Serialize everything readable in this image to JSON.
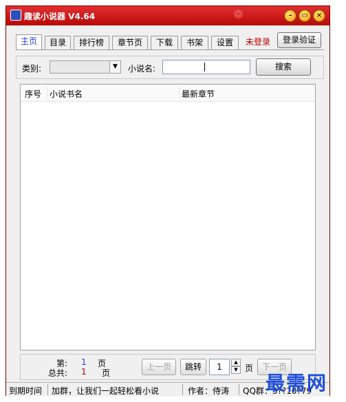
{
  "window": {
    "title": "趣读小说器 V4.64",
    "controls": {
      "minimize": "–",
      "maximize": "▭",
      "close": "×"
    }
  },
  "tabs": [
    "主页",
    "目录",
    "排行榜",
    "章节页",
    "下载",
    "书架",
    "设置"
  ],
  "active_tab": 0,
  "login": {
    "status": "未登录",
    "button": "登录验证"
  },
  "search": {
    "category_label": "类别:",
    "category_value": "",
    "name_label": "小说名:",
    "name_value": "",
    "button": "搜索"
  },
  "table": {
    "columns": [
      "序号",
      "小说书名",
      "最新章节"
    ],
    "rows": []
  },
  "pager": {
    "current_label": "第:",
    "current_value": "1",
    "current_unit": "页",
    "total_label": "总共:",
    "total_value": "1",
    "total_unit": "页",
    "prev": "上一页",
    "jump": "跳转",
    "page_input": "1",
    "page_unit": "页",
    "next": "下一页"
  },
  "statusbar": {
    "expire": "到期时间",
    "group": "加群，让我们一起轻松看小说",
    "author": "作者：侍涛",
    "qq": "QQ群：3??10?79"
  },
  "watermark": "最需网",
  "colors": {
    "title_bar": "#c81010",
    "active_tab": "#1f3fd0",
    "login_status": "#c00000",
    "watermark": "#1f4fd8"
  }
}
